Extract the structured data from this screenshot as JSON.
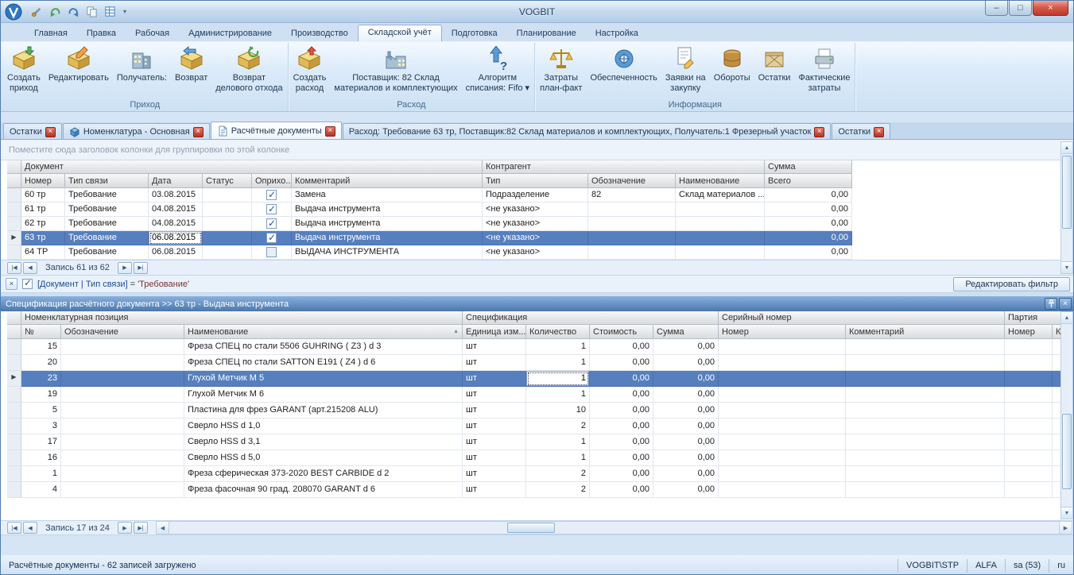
{
  "titlebar": {
    "title": "VOGBIT"
  },
  "icons": {
    "minimize": "–",
    "maximize": "□",
    "close": "×",
    "dropdown": "▾",
    "sort_asc": "▲",
    "row_indicator": "▶",
    "nav_first": "|◀",
    "nav_prev": "◀",
    "nav_next": "▶",
    "nav_last": "▶|",
    "scroll_up": "▲",
    "scroll_down": "▼",
    "scroll_left": "◀",
    "scroll_right": "▶"
  },
  "ribbon": {
    "tabs": [
      "Главная",
      "Правка",
      "Рабочая",
      "Администрирование",
      "Производство",
      "Складской учёт",
      "Подготовка",
      "Планирование",
      "Настройка"
    ],
    "groups": [
      {
        "caption": "Приход",
        "buttons": [
          {
            "label": "Создать\nприход"
          },
          {
            "label": "Редактировать"
          },
          {
            "label": "Получатель:"
          },
          {
            "label": "Возврат"
          },
          {
            "label": "Возврат\nделового отхода"
          }
        ]
      },
      {
        "caption": "Расход",
        "buttons": [
          {
            "label": "Создать\nрасход"
          },
          {
            "label": "Поставщик: 82 Склад\nматериалов и комплектующих"
          },
          {
            "label": "Алгоритм\nсписания: Fifo ▾"
          }
        ]
      },
      {
        "caption": "Информация",
        "buttons": [
          {
            "label": "Затраты\nплан-факт"
          },
          {
            "label": "Обеспеченность"
          },
          {
            "label": "Заявки на\nзакупку"
          },
          {
            "label": "Обороты"
          },
          {
            "label": "Остатки"
          },
          {
            "label": "Фактические\nзатраты"
          }
        ]
      }
    ]
  },
  "doc_tabs": [
    {
      "label": "Остатки"
    },
    {
      "label": "Номенклатура - Основная"
    },
    {
      "label": "Расчётные документы"
    },
    {
      "label": "Расход: Требование 63 тр, Поставщик:82 Склад материалов и комплектующих, Получатель:1 Фрезерный участок"
    },
    {
      "label": "Остатки"
    }
  ],
  "group_panel": {
    "hint": "Поместите сюда заголовок колонки для группировки по этой колонке"
  },
  "documents_grid": {
    "bands": [
      "Документ",
      "Контрагент",
      "Сумма"
    ],
    "columns": [
      "Номер",
      "Тип связи",
      "Дата",
      "Статус",
      "Оприхо...",
      "Комментарий",
      "Тип",
      "Обозначение",
      "Наименование",
      "Всего"
    ],
    "rows": [
      {
        "number": "60 тр",
        "link_type": "Требование",
        "date": "03.08.2015",
        "status": "",
        "posted": true,
        "comment": "Замена",
        "agent_type": "Подразделение",
        "designation": "82",
        "name": "Склад материалов ...",
        "total": "0,00"
      },
      {
        "number": "61 тр",
        "link_type": "Требование",
        "date": "04.08.2015",
        "status": "",
        "posted": true,
        "comment": "Выдача инструмента",
        "agent_type": "<не указано>",
        "designation": "",
        "name": "",
        "total": "0,00"
      },
      {
        "number": "62 тр",
        "link_type": "Требование",
        "date": "04.08.2015",
        "status": "",
        "posted": true,
        "comment": "Выдача инструмента",
        "agent_type": "<не указано>",
        "designation": "",
        "name": "",
        "total": "0,00"
      },
      {
        "number": "63 тр",
        "link_type": "Требование",
        "date": "06.08.2015",
        "status": "",
        "posted": true,
        "comment": "Выдача инструмента",
        "agent_type": "<не указано>",
        "designation": "",
        "name": "",
        "total": "0,00"
      },
      {
        "number": "64 ТР",
        "link_type": "Требование",
        "date": "06.08.2015",
        "status": "",
        "posted": false,
        "comment": "ВЫДАЧА ИНСТРУМЕНТА",
        "agent_type": "<не указано>",
        "designation": "",
        "name": "",
        "total": "0,00"
      }
    ],
    "navigator": "Запись 61 из 62"
  },
  "filter_bar": {
    "field": "[Документ | Тип связи]",
    "operator": "=",
    "value": "'Требование'",
    "edit_button": "Редактировать фильтр"
  },
  "detail_panel": {
    "caption": "Спецификация расчётного документа >> 63 тр - Выдача инструмента"
  },
  "spec_grid": {
    "bands": [
      "Номенклатурная позиция",
      "Спецификация",
      "Серийный номер",
      "Партия"
    ],
    "columns": [
      "№",
      "Обозначение",
      "Наименование",
      "Единица изм...",
      "Количество",
      "Стоимость",
      "Сумма",
      "Номер",
      "Комментарий",
      "Номер",
      "Комме..."
    ],
    "rows": [
      {
        "no": "15",
        "designation": "",
        "name": "Фреза СПЕЦ по стали  5506 GUHRING ( Z3 )  d 3",
        "unit": "шт",
        "qty": "1",
        "price": "0,00",
        "sum": "0,00",
        "serial": "",
        "serial_comment": "",
        "batch": "",
        "batch_comment": ""
      },
      {
        "no": "20",
        "designation": "",
        "name": "Фреза СПЕЦ по стали  SATTON E191 ( Z4 ) d 6",
        "unit": "шт",
        "qty": "1",
        "price": "0,00",
        "sum": "0,00",
        "serial": "",
        "serial_comment": "",
        "batch": "",
        "batch_comment": ""
      },
      {
        "no": "23",
        "designation": "",
        "name": "Глухой Метчик М 5",
        "unit": "шт",
        "qty": "1",
        "price": "0,00",
        "sum": "0,00",
        "serial": "",
        "serial_comment": "",
        "batch": "",
        "batch_comment": ""
      },
      {
        "no": "19",
        "designation": "",
        "name": "Глухой Метчик М 6",
        "unit": "шт",
        "qty": "1",
        "price": "0,00",
        "sum": "0,00",
        "serial": "",
        "serial_comment": "",
        "batch": "",
        "batch_comment": ""
      },
      {
        "no": "5",
        "designation": "",
        "name": "Пластина для фрез GARANT (арт.215208 ALU)",
        "unit": "шт",
        "qty": "10",
        "price": "0,00",
        "sum": "0,00",
        "serial": "",
        "serial_comment": "",
        "batch": "",
        "batch_comment": ""
      },
      {
        "no": "3",
        "designation": "",
        "name": "Сверло HSS d 1,0",
        "unit": "шт",
        "qty": "2",
        "price": "0,00",
        "sum": "0,00",
        "serial": "",
        "serial_comment": "",
        "batch": "",
        "batch_comment": ""
      },
      {
        "no": "17",
        "designation": "",
        "name": "Сверло HSS d 3,1",
        "unit": "шт",
        "qty": "1",
        "price": "0,00",
        "sum": "0,00",
        "serial": "",
        "serial_comment": "",
        "batch": "",
        "batch_comment": ""
      },
      {
        "no": "16",
        "designation": "",
        "name": "Сверло HSS d 5,0",
        "unit": "шт",
        "qty": "1",
        "price": "0,00",
        "sum": "0,00",
        "serial": "",
        "serial_comment": "",
        "batch": "",
        "batch_comment": ""
      },
      {
        "no": "1",
        "designation": "",
        "name": "Фреза сферическая 373-2020 BEST CARBIDE  d 2",
        "unit": "шт",
        "qty": "2",
        "price": "0,00",
        "sum": "0,00",
        "serial": "",
        "serial_comment": "",
        "batch": "",
        "batch_comment": ""
      },
      {
        "no": "4",
        "designation": "",
        "name": "Фреза фасочная 90 град. 208070 GARANT d 6",
        "unit": "шт",
        "qty": "2",
        "price": "0,00",
        "sum": "0,00",
        "serial": "",
        "serial_comment": "",
        "batch": "",
        "batch_comment": ""
      }
    ],
    "navigator": "Запись 17 из 24"
  },
  "statusbar": {
    "left": "Расчётные документы - 62 записей загружено",
    "panels": [
      "VOGBIT\\STP",
      "ALFA",
      "sa (53)",
      "ru"
    ]
  }
}
